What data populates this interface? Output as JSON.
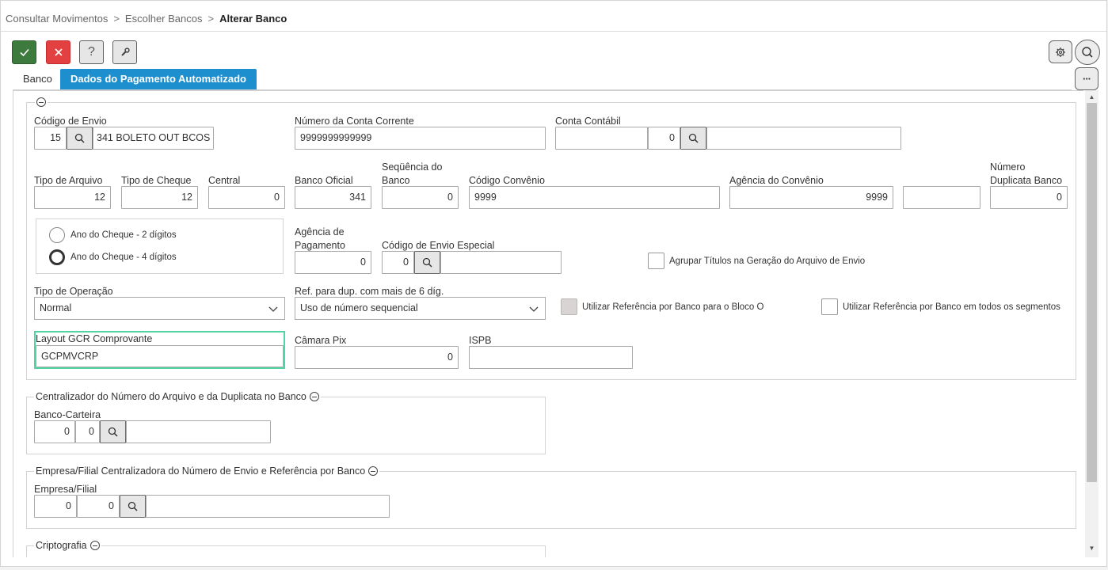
{
  "breadcrumb": {
    "item1": "Consultar Movimentos",
    "item2": "Escolher Bancos",
    "current": "Alterar Banco",
    "separator": ">"
  },
  "toolbar": {
    "confirm_icon": "check-icon",
    "cancel_icon": "close-icon",
    "help_label": "?",
    "tools_icon": "wrench-icon",
    "settings_icon": "gear-icon",
    "search_icon": "search-icon",
    "more_label": "···"
  },
  "tabs": [
    {
      "label": "Banco",
      "active": false
    },
    {
      "label": "Dados do Pagamento Automatizado",
      "active": true
    }
  ],
  "form": {
    "codigo_envio": {
      "label": "Código de Envio",
      "code": "15",
      "desc": "341 BOLETO OUT BCOS"
    },
    "numero_conta": {
      "label": "Número da Conta Corrente",
      "value": "9999999999999"
    },
    "conta_contabil": {
      "label": "Conta Contábil",
      "value": "",
      "code": "0",
      "desc": ""
    },
    "tipo_arquivo": {
      "label": "Tipo de Arquivo",
      "value": "12"
    },
    "tipo_cheque": {
      "label": "Tipo de Cheque",
      "value": "12"
    },
    "central": {
      "label": "Central",
      "value": "0"
    },
    "banco_oficial": {
      "label": "Banco Oficial",
      "value": "341"
    },
    "sequencia_banco": {
      "label": "Seqüência do Banco",
      "value": "0"
    },
    "codigo_convenio": {
      "label": "Código Convênio",
      "value": "9999"
    },
    "agencia_convenio": {
      "label": "Agência do Convênio",
      "value": "9999",
      "extra": ""
    },
    "numero_duplicata": {
      "label": "Número Duplicata Banco",
      "value": "0"
    },
    "ano_cheque": {
      "option1": "Ano do Cheque - 2 dígitos",
      "option2": "Ano do Cheque - 4 dígitos",
      "selected": 2
    },
    "agencia_pagamento": {
      "label": "Agência de Pagamento",
      "value": "0"
    },
    "codigo_envio_especial": {
      "label": "Código de Envio Especial",
      "code": "0",
      "desc": ""
    },
    "agrupar_titulos": {
      "label": "Agrupar Títulos na Geração do Arquivo de Envio",
      "checked": false
    },
    "tipo_operacao": {
      "label": "Tipo de Operação",
      "value": "Normal"
    },
    "ref_dup": {
      "label": "Ref. para dup. com mais de 6 díg.",
      "value": "Uso de número sequencial"
    },
    "ref_bloco_o": {
      "label": "Utilizar Referência por Banco para o Bloco O",
      "checked": false,
      "disabled": true
    },
    "ref_todos": {
      "label": "Utilizar Referência por Banco em todos os segmentos",
      "checked": false
    },
    "layout_gcr": {
      "label": "Layout GCR Comprovante",
      "value": "GCPMVCRP"
    },
    "camara_pix": {
      "label": "Câmara Pix",
      "value": "0"
    },
    "ispb": {
      "label": "ISPB",
      "value": ""
    }
  },
  "section_centralizador": {
    "title": "Centralizador do Número do Arquivo e da Duplicata no Banco",
    "label": "Banco-Carteira",
    "v1": "0",
    "v2": "0",
    "desc": ""
  },
  "section_empresa": {
    "title": "Empresa/Filial Centralizadora do Número de Envio e Referência por Banco",
    "label": "Empresa/Filial",
    "v1": "0",
    "v2": "0",
    "desc": ""
  },
  "section_cripto": {
    "title": "Criptografia"
  }
}
